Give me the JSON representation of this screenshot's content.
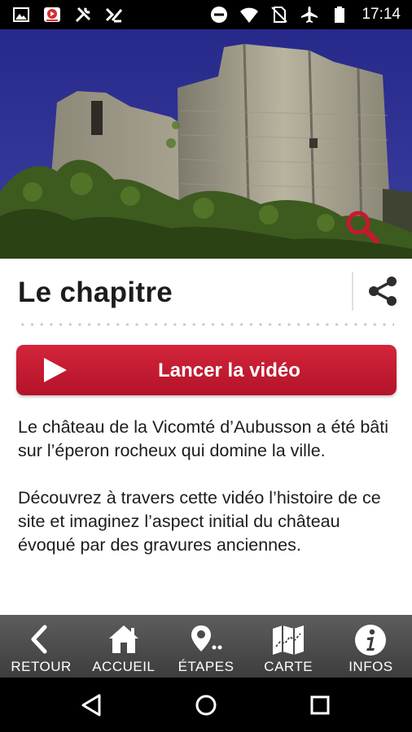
{
  "status_bar": {
    "time": "17:14",
    "left_icons": [
      "image-icon",
      "youtube-icon",
      "tools-icon",
      "check-icon"
    ],
    "right_icons": [
      "dnd-icon",
      "wifi-icon",
      "no-sim-icon",
      "airplane-icon",
      "battery-icon"
    ]
  },
  "hero": {
    "image": "castle-ruins-photo",
    "zoom_icon": "magnifier-icon"
  },
  "page": {
    "title": "Le chapitre",
    "share_icon": "share-icon"
  },
  "video_button": {
    "label": "Lancer la vidéo",
    "icon": "play-icon"
  },
  "description": {
    "paragraphs": [
      "Le château de la Vicomté d’Aubusson a été bâti sur l’éperon rocheux qui domine la ville.",
      "Découvrez à travers cette vidéo l’histoire de ce site et imaginez l’aspect initial du château évoqué par des gravures anciennes."
    ]
  },
  "bottom_nav": {
    "items": [
      {
        "label": "RETOUR",
        "icon": "back-arrow-icon"
      },
      {
        "label": "ACCUEIL",
        "icon": "home-icon"
      },
      {
        "label": "ÉTAPES",
        "icon": "map-pin-icon"
      },
      {
        "label": "CARTE",
        "icon": "folded-map-icon"
      },
      {
        "label": "INFOS",
        "icon": "info-icon"
      }
    ]
  },
  "system_nav": {
    "buttons": [
      "back-triangle-icon",
      "home-circle-icon",
      "recents-square-icon"
    ]
  },
  "colors": {
    "accent": "#c41a30",
    "nav_background": "#4a4a4a",
    "text": "#1c1c1c",
    "sky": "#2b2f8a"
  }
}
